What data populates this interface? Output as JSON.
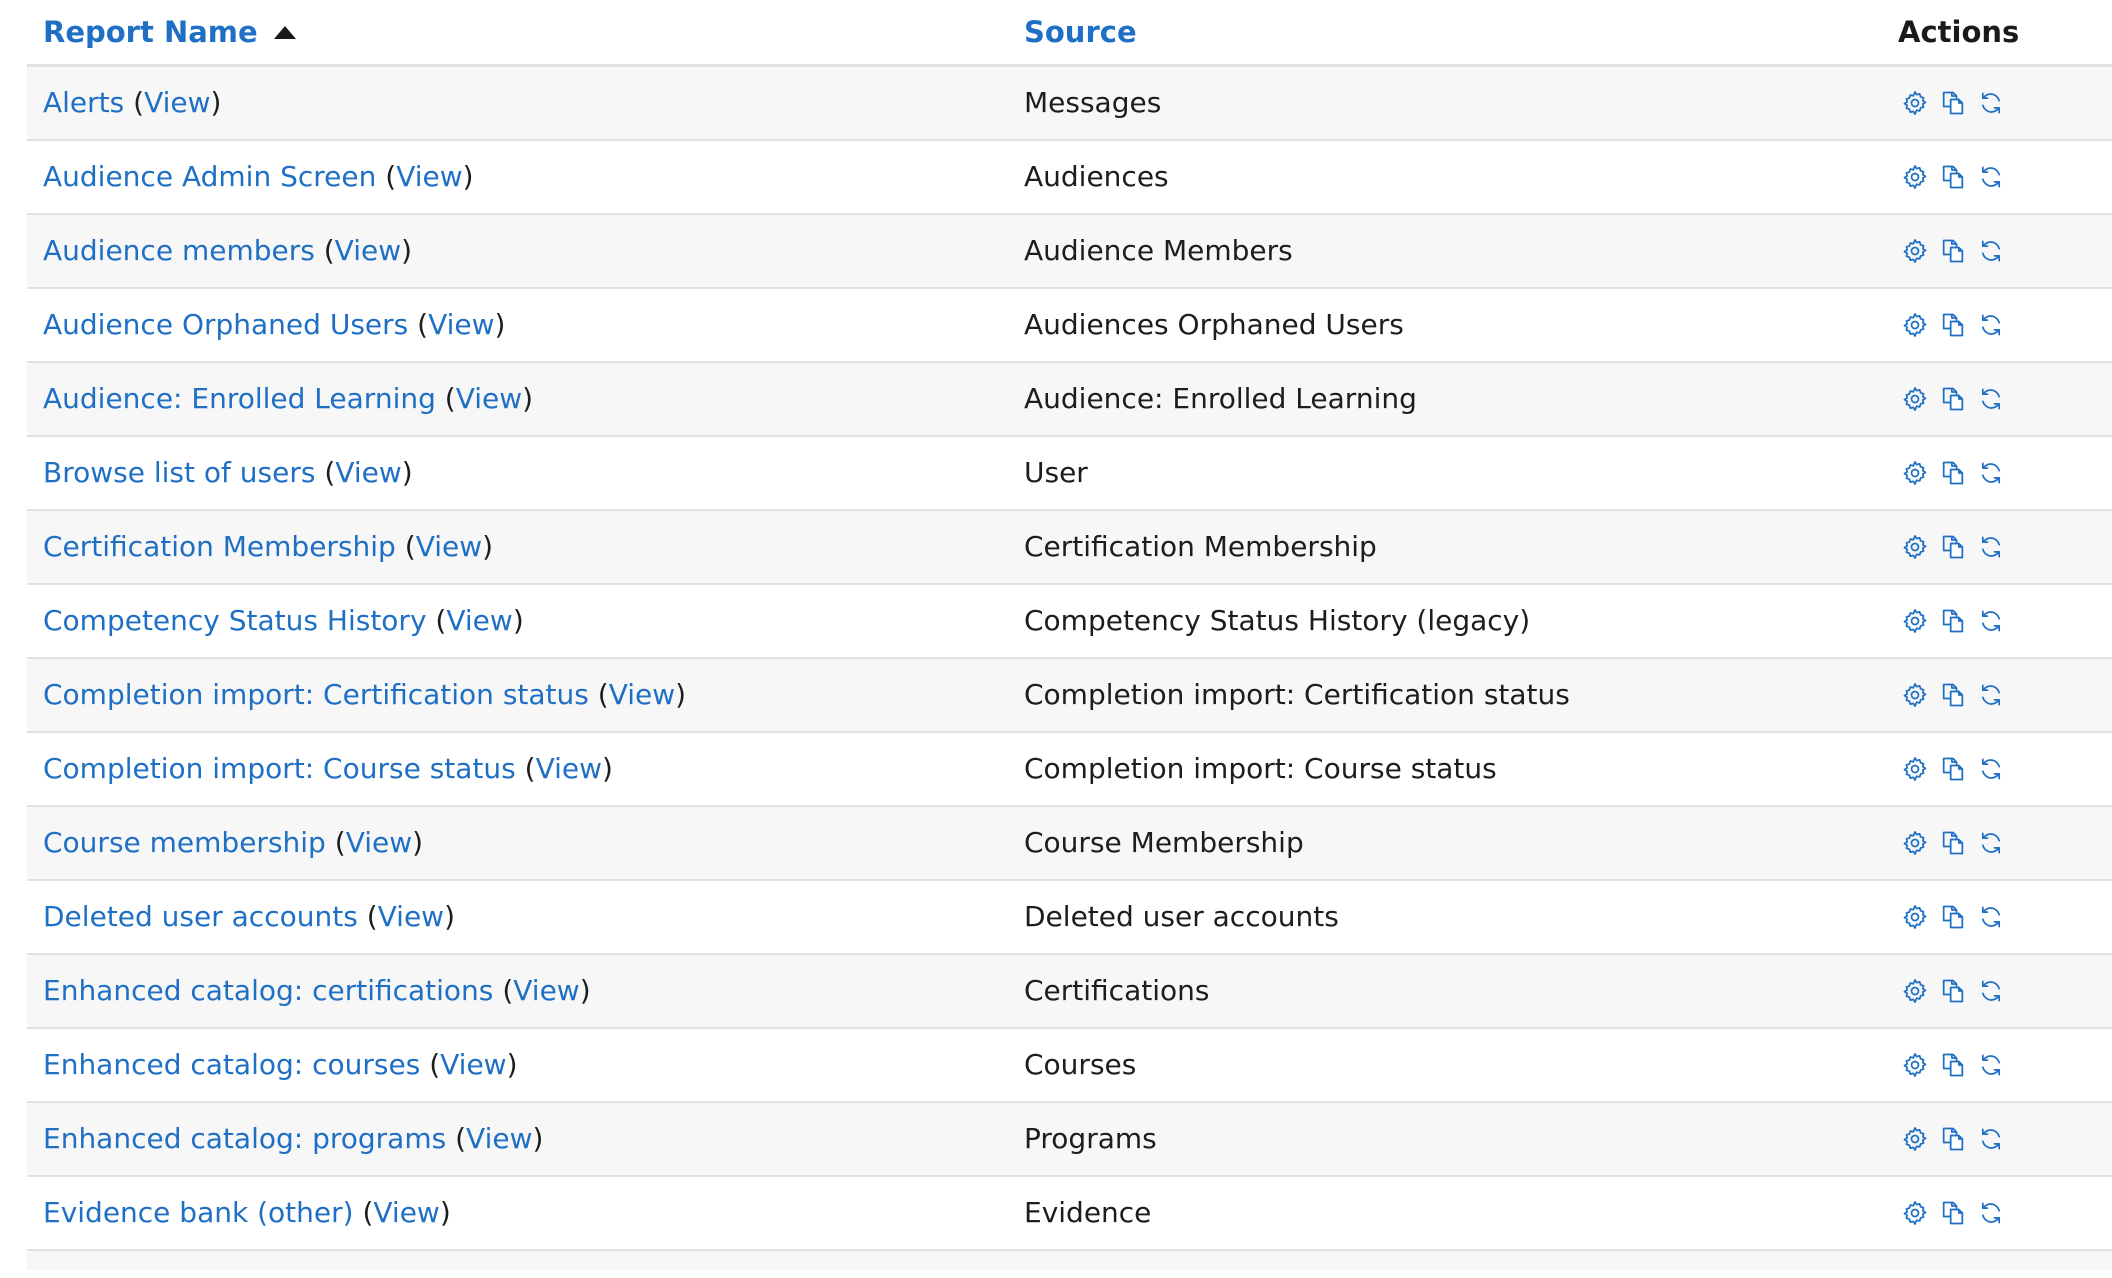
{
  "table": {
    "headers": {
      "name": "Report Name",
      "source": "Source",
      "actions": "Actions"
    },
    "view_label": "View",
    "rows": [
      {
        "name": "Alerts",
        "source": "Messages"
      },
      {
        "name": "Audience Admin Screen",
        "source": "Audiences"
      },
      {
        "name": "Audience members",
        "source": "Audience Members"
      },
      {
        "name": "Audience Orphaned Users",
        "source": "Audiences Orphaned Users"
      },
      {
        "name": "Audience: Enrolled Learning",
        "source": "Audience: Enrolled Learning"
      },
      {
        "name": "Browse list of users",
        "source": "User"
      },
      {
        "name": "Certification Membership",
        "source": "Certification Membership"
      },
      {
        "name": "Competency Status History",
        "source": "Competency Status History (legacy)"
      },
      {
        "name": "Completion import: Certification status",
        "source": "Completion import: Certification status"
      },
      {
        "name": "Completion import: Course status",
        "source": "Completion import: Course status"
      },
      {
        "name": "Course membership",
        "source": "Course Membership"
      },
      {
        "name": "Deleted user accounts",
        "source": "Deleted user accounts"
      },
      {
        "name": "Enhanced catalog: certifications",
        "source": "Certifications"
      },
      {
        "name": "Enhanced catalog: courses",
        "source": "Courses"
      },
      {
        "name": "Enhanced catalog: programs",
        "source": "Programs"
      },
      {
        "name": "Evidence bank (other)",
        "source": "Evidence"
      }
    ]
  },
  "icons": {
    "settings": "gear-icon",
    "clone": "copy-icon",
    "reload": "refresh-icon"
  },
  "colors": {
    "link": "#1f70c4",
    "text": "#1d1d1d",
    "row_alt": "#f7f7f7",
    "border": "#dee2e6"
  }
}
